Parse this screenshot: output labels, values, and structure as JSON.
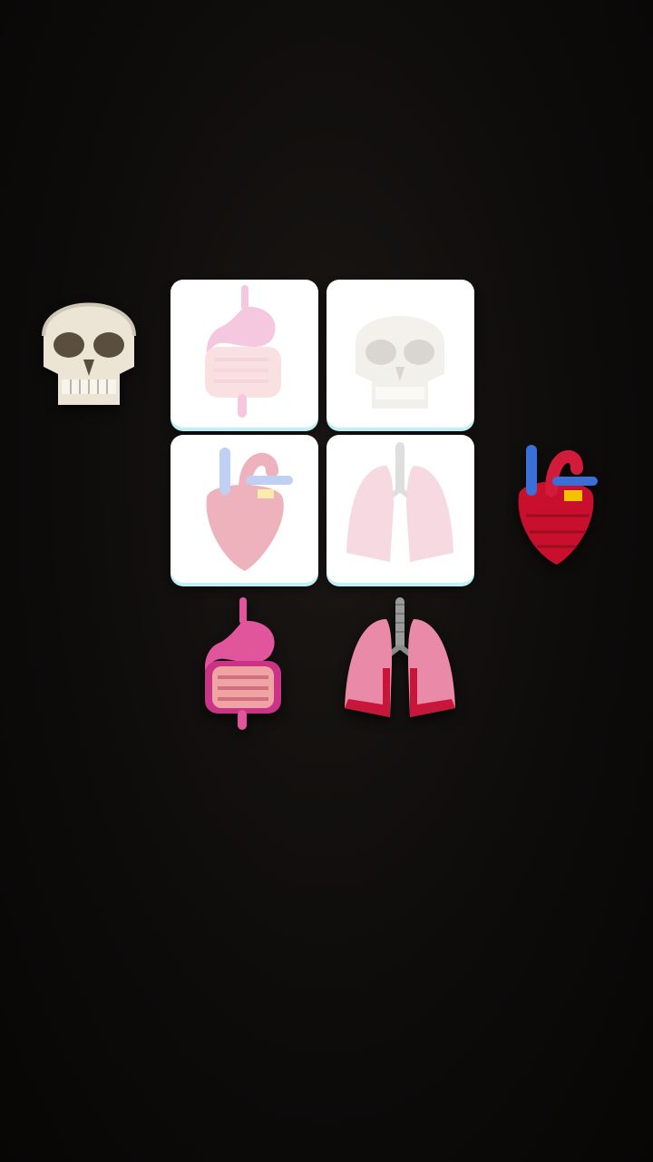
{
  "game": {
    "type": "shadow-match puzzle",
    "slots": [
      {
        "id": "slot-1",
        "target": "stomach-intestines",
        "filled": false
      },
      {
        "id": "slot-2",
        "target": "skull",
        "filled": false
      },
      {
        "id": "slot-3",
        "target": "heart",
        "filled": false
      },
      {
        "id": "slot-4",
        "target": "lungs",
        "filled": false
      }
    ],
    "pieces": [
      {
        "id": "skull",
        "icon": "skull-icon"
      },
      {
        "id": "heart",
        "icon": "heart-icon"
      },
      {
        "id": "stomach-intestines",
        "icon": "stomach-intestines-icon"
      },
      {
        "id": "lungs",
        "icon": "lungs-icon"
      }
    ],
    "colors": {
      "slot": "#ffffff",
      "slot_edge": "#bff0f6",
      "background": "#0e0c0b",
      "skull": "#ece5d6",
      "heart": "#c8102e",
      "artery": "#3a6fd8",
      "stomach": "#e0559c",
      "intestine": "#f0a3a3",
      "lung": "#e88aa8",
      "trachea": "#9b9b9b"
    }
  }
}
